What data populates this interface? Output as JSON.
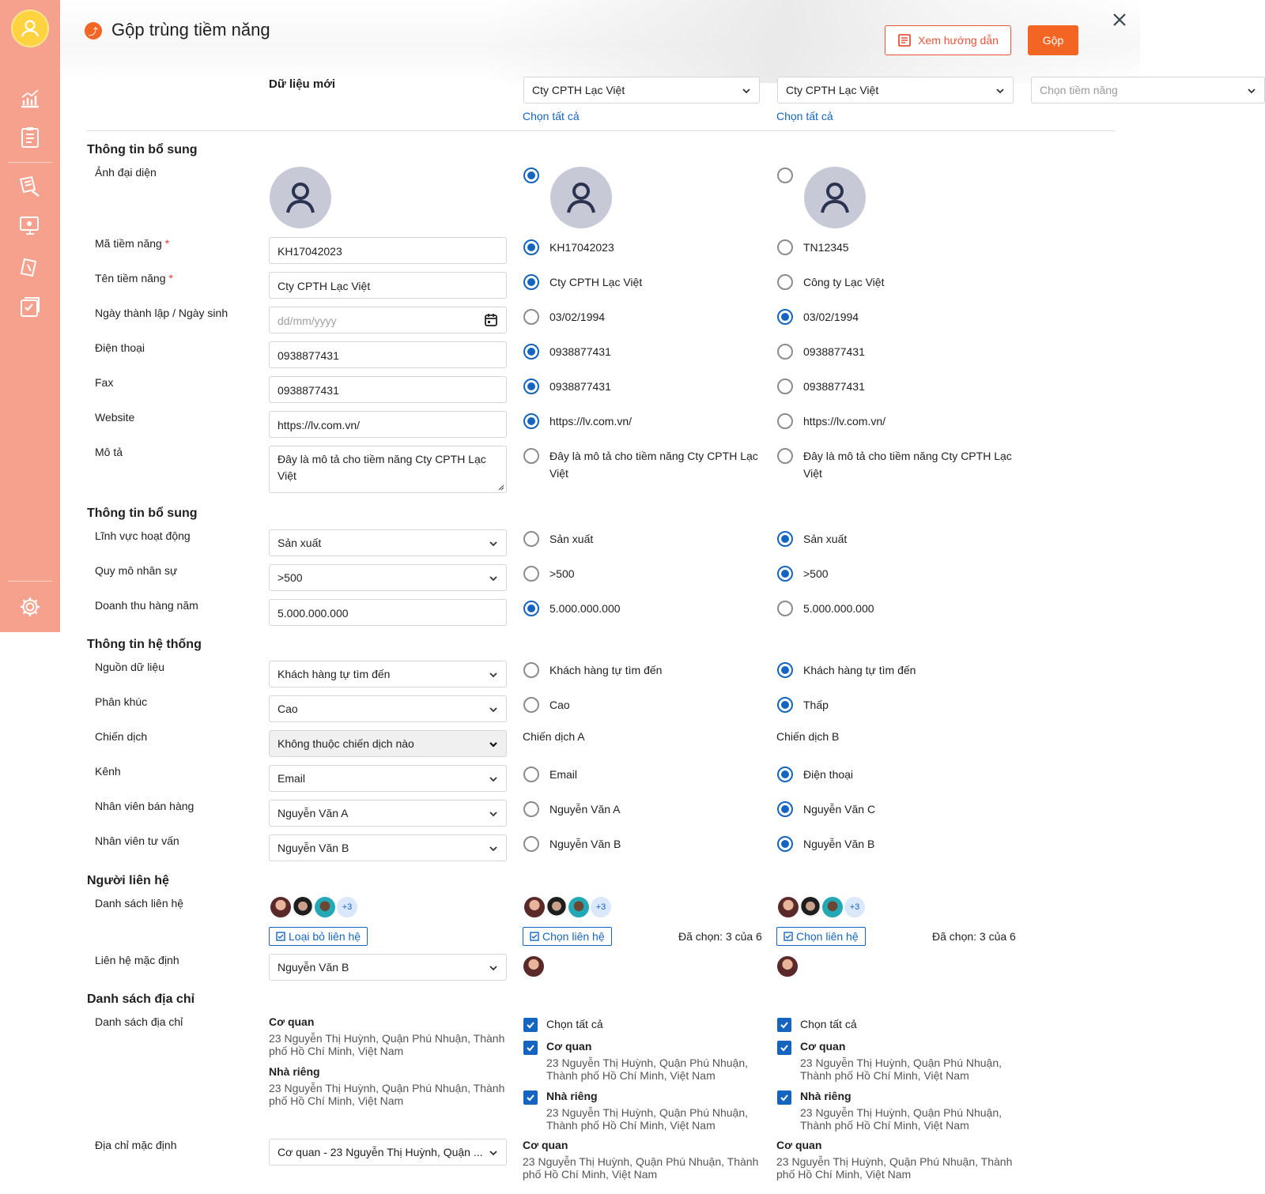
{
  "header": {
    "title": "Gộp trùng tiềm năng",
    "guide_label": "Xem hướng dẫn",
    "merge_label": "Gộp",
    "new_data_label": "Dữ liệu mới"
  },
  "columns": {
    "col1_select": "Cty CPTH Lạc Việt",
    "col2_select": "Cty CPTH Lạc Việt",
    "col3_placeholder": "Chọn tiềm năng",
    "select_all": "Chọn tất cả"
  },
  "sections": {
    "s1": "Thông tin bổ sung",
    "s2": "Thông tin bổ sung",
    "s3": "Thông tin hệ thống",
    "s4": "Người liên hệ",
    "s5": "Danh sách địa chỉ"
  },
  "labels": {
    "avatar": "Ảnh đại diện",
    "code": "Mã tiềm năng",
    "name": "Tên tiềm năng",
    "date": "Ngày thành lập / Ngày sinh",
    "phone": "Điện thoại",
    "fax": "Fax",
    "website": "Website",
    "desc": "Mô tả",
    "field": "Lĩnh vực hoạt động",
    "scale": "Quy mô nhân sự",
    "revenue": "Doanh thu hàng năm",
    "source": "Nguồn dữ liệu",
    "segment": "Phân khúc",
    "campaign": "Chiến dịch",
    "channel": "Kênh",
    "sales": "Nhân viên bán hàng",
    "consultant": "Nhân viên tư vấn",
    "contact_list": "Danh sách liên hệ",
    "default_contact": "Liên hệ mặc định",
    "address_list": "Danh sách địa chỉ",
    "default_address": "Địa chỉ mặc định",
    "required_mark": "*"
  },
  "new_data": {
    "code": "KH17042023",
    "name": "Cty CPTH Lạc Việt",
    "date_placeholder": "dd/mm/yyyy",
    "phone": "0938877431",
    "fax": "0938877431",
    "website": "https://lv.com.vn/",
    "desc": "Đây là mô tả cho tiềm năng Cty CPTH Lạc Việt",
    "field": "Sản xuất",
    "scale": ">500",
    "revenue": "5.000.000.000",
    "source": "Khách hàng tự tìm đến",
    "segment": "Cao",
    "campaign": "Không thuộc chiến dịch nào",
    "channel": "Email",
    "sales": "Nguyễn Văn A",
    "consultant": "Nguyễn Văn B",
    "remove_contact": "Loại bỏ liên hệ",
    "default_contact": "Nguyễn Văn B",
    "default_address": "Cơ quan - 23 Nguyễn Thị Huỳnh, Quận ..."
  },
  "col1": {
    "code": "KH17042023",
    "name": "Cty CPTH Lạc Việt",
    "date": "03/02/1994",
    "phone": "0938877431",
    "fax": "0938877431",
    "website": "https://lv.com.vn/",
    "desc": "Đây là mô tả cho tiềm năng Cty CPTH Lạc Việt",
    "field": "Sản xuất",
    "scale": ">500",
    "revenue": "5.000.000.000",
    "source": "Khách hàng tự tìm đến",
    "segment": "Cao",
    "campaign": "Chiến dịch A",
    "channel": "Email",
    "sales": "Nguyễn Văn A",
    "consultant": "Nguyễn Văn B",
    "choose_contact": "Chọn liên hệ",
    "selected_count": "Đã chọn: 3 của 6"
  },
  "col2": {
    "code": "TN12345",
    "name": "Công ty Lạc Việt",
    "date": "03/02/1994",
    "phone": "0938877431",
    "fax": "0938877431",
    "website": "https://lv.com.vn/",
    "desc": "Đây là mô tả cho tiềm năng Cty CPTH Lạc Việt",
    "field": "Sản xuất",
    "scale": ">500",
    "revenue": "5.000.000.000",
    "source": "Khách hàng tự tìm đến",
    "segment": "Thấp",
    "campaign": "Chiến dịch B",
    "channel": "Điện thoại",
    "sales": "Nguyễn Văn C",
    "consultant": "Nguyễn Văn B",
    "choose_contact": "Chọn liên hệ",
    "selected_count": "Đã chọn: 3 của 6"
  },
  "contacts": {
    "more": "+3"
  },
  "addresses": {
    "office_title": "Cơ quan",
    "home_title": "Nhà riêng",
    "office_line1_a": "23 Nguyễn Thị Huỳnh, Quận Phú Nhuận, Thành",
    "office_line2_a": "phố Hồ Chí Minh, Việt Nam",
    "office_line1_b": "23 Nguyễn Thị Huỳnh, Quận Phú Nhuận,",
    "office_line2_b": "Thành phố Hồ Chí Minh, Việt Nam",
    "select_all": "Chọn tất cả"
  },
  "colors": {
    "sidebar": "#f6a08e",
    "accent": "#f26522",
    "primary": "#1565c0"
  }
}
